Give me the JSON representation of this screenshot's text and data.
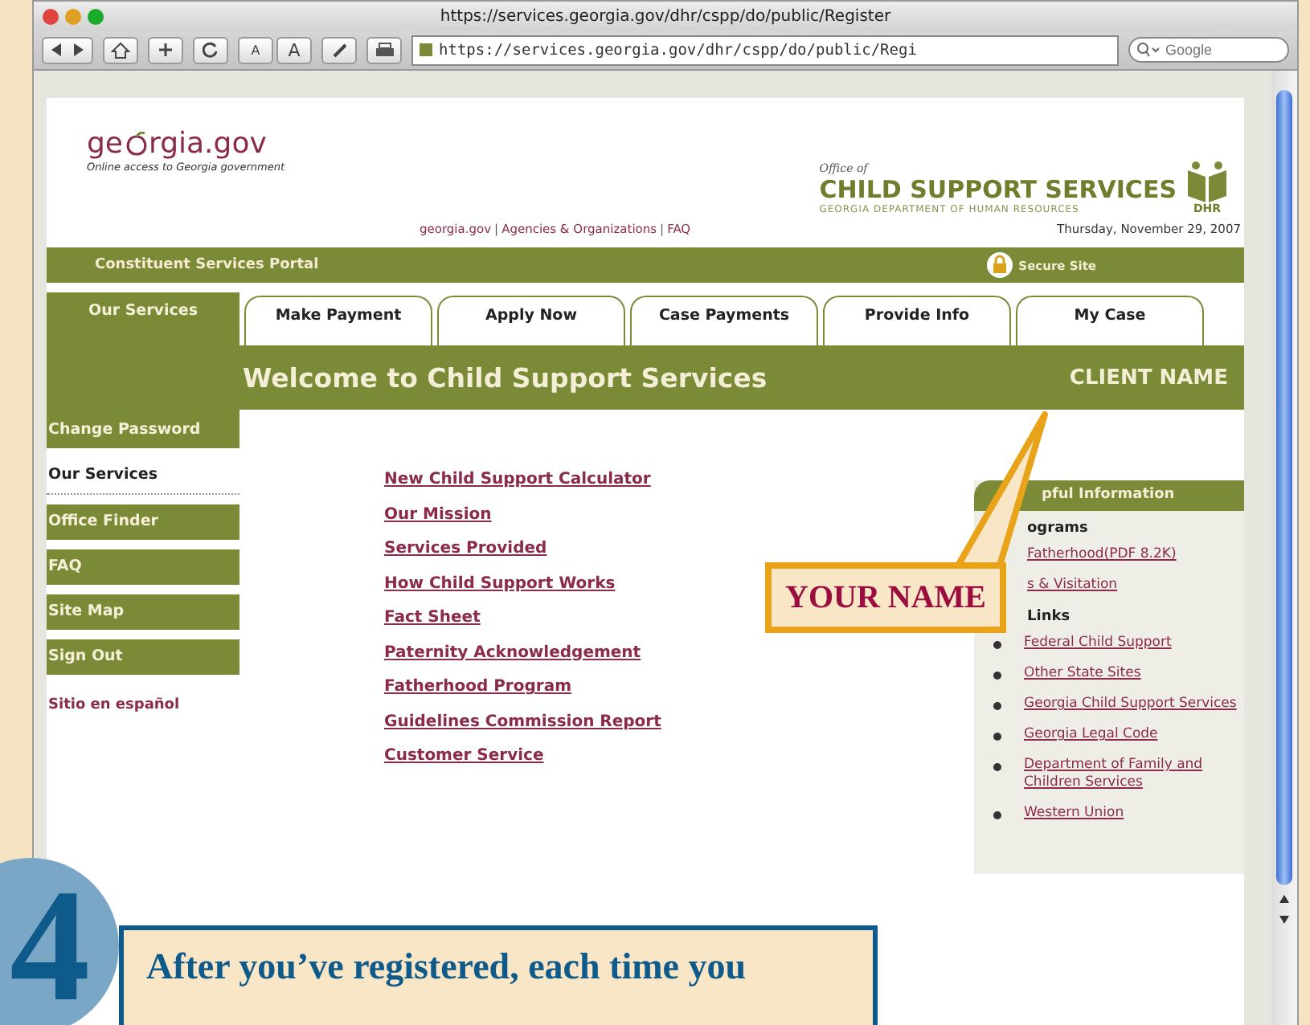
{
  "browser": {
    "title": "https://services.georgia.gov/dhr/cspp/do/public/Register",
    "text_size_buttons": [
      "A",
      "A"
    ],
    "address": "https://services.georgia.gov/dhr/cspp/do/public/Regi",
    "search": {
      "placeholder": "Google"
    }
  },
  "header": {
    "logo_start": "ge",
    "logo_end": "rgia.gov",
    "tagline": "Online access to Georgia government",
    "office_of": "Office of",
    "agency": "CHILD SUPPORT SERVICES",
    "department": "GEORGIA DEPARTMENT OF HUMAN RESOURCES",
    "agency_logo": "DHR"
  },
  "top_links": [
    "georgia.gov",
    "Agencies & Organizations",
    "FAQ"
  ],
  "top_links_separator": "|",
  "date": "Thursday, November 29, 2007",
  "portal_bar": {
    "title": "Constituent Services Portal",
    "secure": "Secure Site"
  },
  "tabs": [
    {
      "label": "Our Services",
      "selected": true
    },
    {
      "label": "Make Payment",
      "selected": false
    },
    {
      "label": "Apply Now",
      "selected": false
    },
    {
      "label": "Case Payments",
      "selected": false
    },
    {
      "label": "Provide Info",
      "selected": false
    },
    {
      "label": "My Case",
      "selected": false
    }
  ],
  "welcome": {
    "title": "Welcome to Child Support Services",
    "client": "CLIENT NAME"
  },
  "side_nav": [
    {
      "label": "Change Password",
      "kind": "button",
      "selected": false
    },
    {
      "label": "Our Services",
      "kind": "button",
      "selected": true
    },
    {
      "label": "Office Finder",
      "kind": "button",
      "selected": false
    },
    {
      "label": "FAQ",
      "kind": "button",
      "selected": false
    },
    {
      "label": "Site Map",
      "kind": "button",
      "selected": false
    },
    {
      "label": "Sign Out",
      "kind": "button",
      "selected": false
    },
    {
      "label": "Sitio en español",
      "kind": "link"
    }
  ],
  "main_links": [
    "New Child Support Calculator",
    "Our Mission",
    "Services Provided",
    "How Child Support Works",
    "Fact Sheet",
    "Paternity Acknowledgement",
    "Fatherhood Program",
    "Guidelines Commission Report",
    "Customer Service"
  ],
  "info_panel": {
    "title": "pful Information",
    "sections": [
      {
        "heading": "ograms",
        "kind": "plain",
        "links": [
          "Fatherhood(PDF 8.2K)",
          "s & Visitation"
        ]
      },
      {
        "heading": "Links",
        "kind": "bulleted",
        "links": [
          "Federal Child Support",
          "Other State Sites",
          "Georgia Child Support Services",
          "Georgia Legal Code",
          "Department of Family and Children Services",
          "Western Union"
        ]
      }
    ]
  },
  "callout": {
    "label": "YOUR NAME"
  },
  "step": {
    "number": "4",
    "text": "After you’ve registered, each time you"
  }
}
